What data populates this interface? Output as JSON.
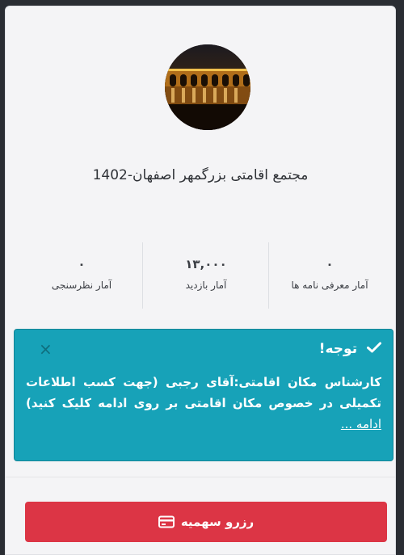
{
  "place": {
    "title": "مجتمع اقامتی بزرگمهر اصفهان-1402"
  },
  "stats": [
    {
      "value": "۰",
      "label": "آمار معرفی نامه ها"
    },
    {
      "value": "۱۳,۰۰۰",
      "label": "آمار بازدید"
    },
    {
      "value": "۰",
      "label": "آمار نظرسنجی"
    }
  ],
  "alert": {
    "heading": "توجه!",
    "close": "×",
    "body": "کارشناس مکان اقامتی:آقای رجبی (جهت کسب اطلاعات تکمیلی در خصوص مکان اقامتی بر روی ادامه کلیک کنید)",
    "link": "ادامه ..."
  },
  "actions": {
    "reserve_label": "رزرو سهمیه"
  },
  "colors": {
    "info": "#17a2b8",
    "danger": "#dc3545"
  }
}
